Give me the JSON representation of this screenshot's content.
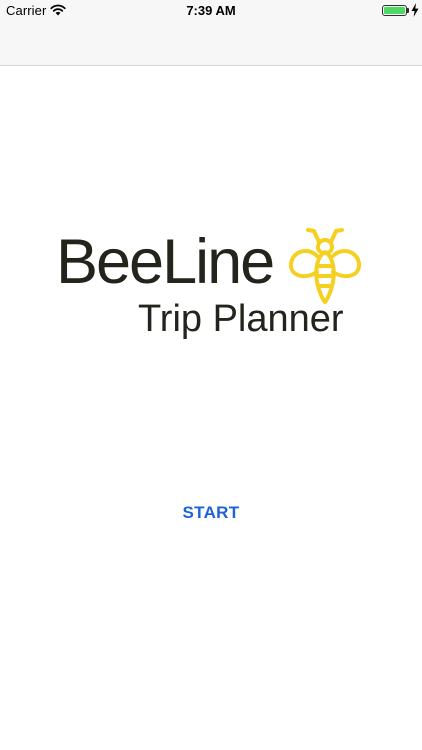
{
  "status_bar": {
    "carrier": "Carrier",
    "time": "7:39 AM",
    "battery_level": 1.0,
    "battery_color": "#4cd964",
    "wifi_icon": "wifi-icon",
    "charging_icon": "bolt-icon"
  },
  "logo": {
    "title": "BeeLine",
    "subtitle": "Trip Planner",
    "icon": "bee-icon",
    "bee_color": "#f5d020",
    "text_color": "#24241d"
  },
  "main": {
    "start_label": "START",
    "start_color": "#1e63d6"
  }
}
